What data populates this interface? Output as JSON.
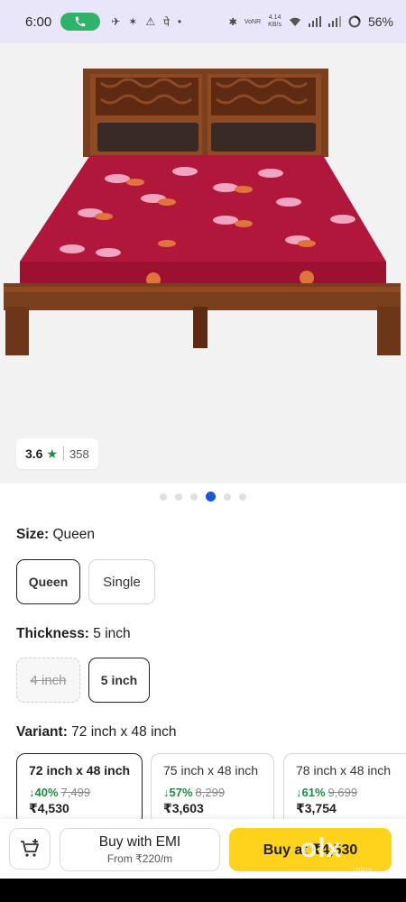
{
  "status_bar": {
    "time": "6:00",
    "net_speed_top": "4.14",
    "net_speed_bottom": "KB/s",
    "battery": "56%"
  },
  "rating": {
    "value": "3.6",
    "count": "358"
  },
  "carousel": {
    "total": 6,
    "active_index": 3
  },
  "size": {
    "label": "Size:",
    "selected_value": "Queen",
    "options": [
      "Queen",
      "Single"
    ]
  },
  "thickness": {
    "label": "Thickness:",
    "selected_value": "5 inch",
    "options": [
      "4 inch",
      "5 inch"
    ]
  },
  "variant": {
    "label": "Variant:",
    "selected_value": "72 inch x 48 inch",
    "cards": [
      {
        "name": "72 inch x 48 inch",
        "discount": "↓40%",
        "mrp": "7,499",
        "price": "₹4,530"
      },
      {
        "name": "75 inch x 48 inch",
        "discount": "↓57%",
        "mrp": "8,299",
        "price": "₹3,603"
      },
      {
        "name": "78 inch x 48 inch",
        "discount": "↓61%",
        "mrp": "9,699",
        "price": "₹3,754"
      }
    ]
  },
  "bottom_bar": {
    "emi_title": "Buy with EMI",
    "emi_sub": "From ₹220/m",
    "buy_label": "Buy at ₹4,530"
  },
  "watermark": {
    "brand": "olx",
    "sub": "INDIA"
  },
  "colors": {
    "status_bg": "#e9e6f9",
    "call_green": "#2fb36a",
    "rating_green": "#1c8a43",
    "dot_active": "#1a56db",
    "buy_yellow": "#ffd21c",
    "mattress_red": "#b0173a",
    "bed_wood": "#7a3f1c"
  }
}
